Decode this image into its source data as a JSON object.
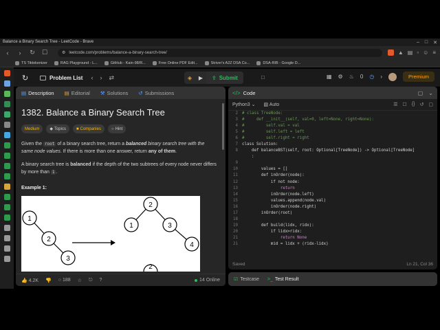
{
  "browser": {
    "window_title": "Balance a Binary Search Tree - LeetCode - Brave",
    "url": "leetcode.com/problems/balance-a-binary-search-tree/",
    "bookmarks": [
      {
        "label": "TS Tiktokenizer",
        "color": "#4a90d9"
      },
      {
        "label": "RAG Playground - L...",
        "color": "#c04080"
      },
      {
        "label": "GitHub - Kain-98/R...",
        "color": "#888888"
      },
      {
        "label": "Free Online PDF Edit...",
        "color": "#2f6ecf"
      },
      {
        "label": "Striver's A2Z DSA Co...",
        "color": "#d97a2b"
      },
      {
        "label": "DSA-RIB - Google D...",
        "color": "#2e9a4c"
      }
    ],
    "sidebar_icon_colors": [
      "#e55a2b",
      "#6aa4e6",
      "#5ab85a",
      "#2f8f4f",
      "#3fa66a",
      "#888888",
      "#47a7e0",
      "#2e9a4c",
      "#2e9a4c",
      "#2e9a4c",
      "#2e9a4c",
      "#d6a53a",
      "#2e9a4c",
      "#2e9a4c",
      "#2e9a4c",
      "#999999",
      "#999999",
      "#999999",
      "#999999"
    ]
  },
  "lc_top": {
    "problem_list": "Problem List",
    "submit": "Submit",
    "streak": "0",
    "premium": "Premium"
  },
  "left_tabs": [
    {
      "label": "Description",
      "active": true
    },
    {
      "label": "Editorial",
      "active": false
    },
    {
      "label": "Solutions",
      "active": false
    },
    {
      "label": "Submissions",
      "active": false
    }
  ],
  "problem": {
    "title": "1382. Balance a Binary Search Tree",
    "difficulty": "Medium",
    "topics": "Topics",
    "companies": "Companies",
    "hint": "Hint",
    "p1_a": "Given the ",
    "p1_code": "root",
    "p1_b": " of a binary search tree, return a ",
    "p1_bold": "balanced",
    "p1_c": " binary search tree with the same node values",
    "p1_d": ". If there is more than one answer, return ",
    "p1_any": "any of them",
    "p1_e": ".",
    "p2_a": "A binary search tree is ",
    "p2_bold": "balanced",
    "p2_b": " if the depth of the two subtrees of every node never differs by more than ",
    "p2_code": "1",
    "p2_c": ".",
    "example": "Example 1:",
    "tree_left": [
      "1",
      "2",
      "3"
    ],
    "tree_right": [
      "2",
      "1",
      "3",
      "4"
    ],
    "tree_bottom": "2"
  },
  "left_footer": {
    "likes": "4.2K",
    "comments": "188",
    "online": "14 Online"
  },
  "code_panel": {
    "title": "Code",
    "language": "Python3",
    "mode": "Auto",
    "status": "Saved",
    "cursor": "Ln 21, Col 36",
    "lines": [
      {
        "n": "2",
        "t": "# class TreeNode:",
        "c": "#6a9955"
      },
      {
        "n": "3",
        "t": "#     def __init__(self, val=0, left=None, right=None):",
        "c": "#6a9955"
      },
      {
        "n": "4",
        "t": "#         self.val = val",
        "c": "#6a9955"
      },
      {
        "n": "5",
        "t": "#         self.left = left",
        "c": "#6a9955"
      },
      {
        "n": "6",
        "t": "#         self.right = right",
        "c": "#6a9955"
      },
      {
        "n": "7",
        "t": "class Solution:",
        "c": "#d4d4d4"
      },
      {
        "n": "8",
        "t": "    def balanceBST(self, root: Optional[TreeNode]) -> Optional[TreeNode]",
        "c": "#d4d4d4"
      },
      {
        "n": "",
        "t": "    :",
        "c": "#d4d4d4"
      },
      {
        "n": "9",
        "t": "",
        "c": "#d4d4d4"
      },
      {
        "n": "10",
        "t": "        values = []",
        "c": "#d4d4d4"
      },
      {
        "n": "11",
        "t": "        def inOrder(node):",
        "c": "#d4d4d4"
      },
      {
        "n": "12",
        "t": "            if not node:",
        "c": "#d4d4d4"
      },
      {
        "n": "13",
        "t": "                return",
        "c": "#c586c0"
      },
      {
        "n": "14",
        "t": "            inOrder(node.left)",
        "c": "#d4d4d4"
      },
      {
        "n": "15",
        "t": "            values.append(node.val)",
        "c": "#d4d4d4"
      },
      {
        "n": "16",
        "t": "            inOrder(node.right)",
        "c": "#d4d4d4"
      },
      {
        "n": "17",
        "t": "        inOrder(root)",
        "c": "#d4d4d4"
      },
      {
        "n": "18",
        "t": "",
        "c": "#d4d4d4"
      },
      {
        "n": "19",
        "t": "        def build(lidx, ridx):",
        "c": "#d4d4d4"
      },
      {
        "n": "20",
        "t": "            if lidx>ridx:",
        "c": "#d4d4d4"
      },
      {
        "n": "21",
        "t": "                return None",
        "c": "#c586c0"
      },
      {
        "n": "21",
        "t": "            mid = lidx + (ridx-lidx)",
        "c": "#d4d4d4"
      }
    ]
  },
  "bottom_tabs": [
    {
      "label": "Testcase",
      "active": false
    },
    {
      "label": "Test Result",
      "active": true
    }
  ]
}
